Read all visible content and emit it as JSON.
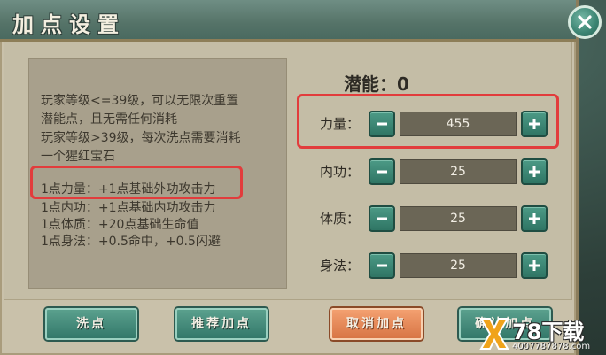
{
  "dialog": {
    "title": "加点设置"
  },
  "info": {
    "lines": [
      "玩家等级<=39级，可以无限次重置",
      "潜能点，且无需任何消耗",
      "玩家等级>39级，每次洗点需要消耗",
      "一个猩红宝石",
      "1点力量：+1点基础外功攻击力",
      "1点内功：+1点基础内功攻击力",
      "1点体质：+20点基础生命值",
      "1点身法：+0.5命中，+0.5闪避"
    ]
  },
  "potential": {
    "label": "潜能：",
    "value": "0"
  },
  "stats": [
    {
      "label": "力量：",
      "value": "455"
    },
    {
      "label": "内功：",
      "value": "25"
    },
    {
      "label": "体质：",
      "value": "25"
    },
    {
      "label": "身法：",
      "value": "25"
    }
  ],
  "buttons": {
    "reset": "洗点",
    "recommend": "推荐加点",
    "cancel": "取消加点",
    "confirm": "确认加点"
  },
  "watermark": {
    "main": "78下载",
    "sub": "4007787878.com"
  },
  "colors": {
    "highlight_box": "#e23c3c",
    "green_button": "#3f8a77",
    "orange_button": "#e6875a",
    "title_bar": "#557368"
  },
  "icons": {
    "close": "close-x-icon",
    "minus": "minus-icon",
    "plus": "plus-icon",
    "logo": "x-logo-icon"
  }
}
